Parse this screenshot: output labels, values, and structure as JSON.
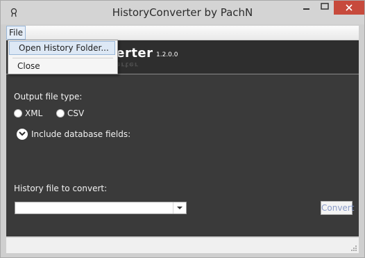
{
  "window": {
    "title": "HistoryConverter by PachN"
  },
  "menu": {
    "file_label": "File",
    "items": [
      {
        "label": "Open History Folder..."
      },
      {
        "label": "Close"
      }
    ]
  },
  "header": {
    "app_name": "verter",
    "version": "1.2.0.0"
  },
  "form": {
    "output_type_label": "Output file type:",
    "options": [
      {
        "label": "XML"
      },
      {
        "label": "CSV"
      }
    ],
    "include_fields_label": "Include database fields:",
    "history_file_label": "History file to convert:",
    "history_file_value": "",
    "convert_label": "Convert"
  },
  "colors": {
    "close_button": "#c74a3c",
    "content_bg": "#3a3a3a",
    "convert_text": "#8a9bc8"
  }
}
